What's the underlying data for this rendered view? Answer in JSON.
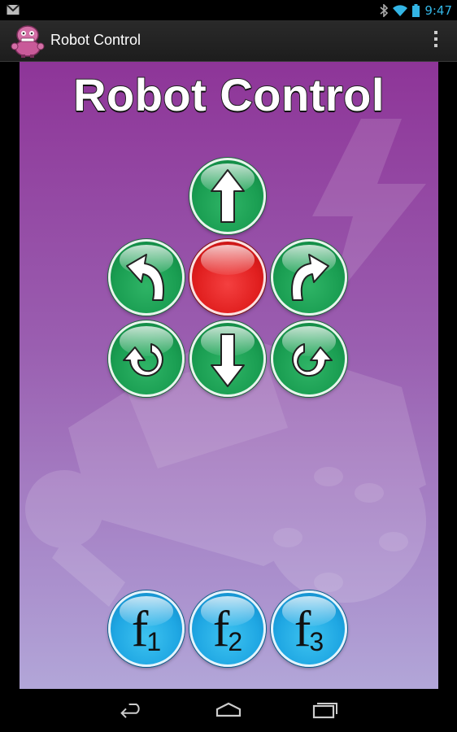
{
  "status_bar": {
    "time": "9:47",
    "icons": [
      "gmail-notification-icon",
      "bluetooth-icon",
      "wifi-icon",
      "battery-icon"
    ]
  },
  "action_bar": {
    "title": "Robot Control",
    "app_icon": "robot-app-icon",
    "overflow_icon": "overflow-menu-icon"
  },
  "page": {
    "title": "Robot Control"
  },
  "controls": {
    "forward": "arrow-up-icon",
    "turn_left": "curved-arrow-left-icon",
    "stop": "stop",
    "turn_right": "curved-arrow-right-icon",
    "rotate_left": "rotate-ccw-icon",
    "backward": "arrow-down-icon",
    "rotate_right": "rotate-cw-icon"
  },
  "function_buttons": [
    {
      "letter": "f",
      "number": "1"
    },
    {
      "letter": "f",
      "number": "2"
    },
    {
      "letter": "f",
      "number": "3"
    }
  ],
  "colors": {
    "direction_buttons": "#1a9e52",
    "stop_button": "#e11f1f",
    "function_buttons": "#1fa7e3",
    "status_time": "#33b5e5"
  },
  "nav_bar": {
    "icons": [
      "back-icon",
      "home-icon",
      "recent-apps-icon"
    ]
  }
}
